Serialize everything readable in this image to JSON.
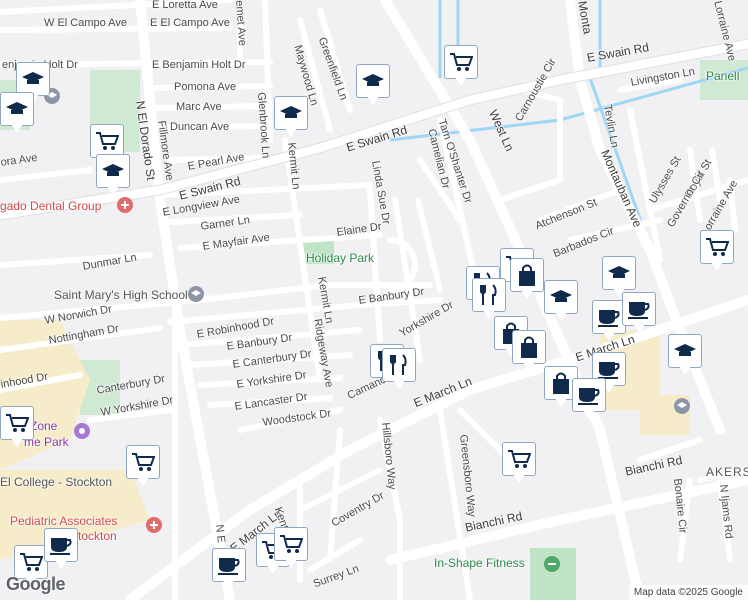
{
  "map": {
    "streets": [
      {
        "label": "E Loretta Ave"
      },
      {
        "label": "W El Campo Ave"
      },
      {
        "label": "E El Campo Ave"
      },
      {
        "label": "enjamin Holt Dr"
      },
      {
        "label": "E Benjamin Holt Dr"
      },
      {
        "label": "Pomona Ave"
      },
      {
        "label": "Marc Ave"
      },
      {
        "label": "Duncan Ave"
      },
      {
        "label": "E Pearl Ave"
      },
      {
        "label": "ora Ave"
      },
      {
        "label": "E Swain Rd"
      },
      {
        "label": "E Swain Rd"
      },
      {
        "label": "E Longview Ave"
      },
      {
        "label": "Garner Ln"
      },
      {
        "label": "E Mayfair Ave"
      },
      {
        "label": "Elaine Dr"
      },
      {
        "label": "Dunmar Ln"
      },
      {
        "label": "W Norwich Dr"
      },
      {
        "label": "Nottingham Dr"
      },
      {
        "label": "E Robinhood Dr"
      },
      {
        "label": "E Banbury Dr"
      },
      {
        "label": "E Banbury Dr"
      },
      {
        "label": "E Canterbury Dr"
      },
      {
        "label": "E Yorkshire Dr"
      },
      {
        "label": "E Lancaster Dr"
      },
      {
        "label": "Woodstock Dr"
      },
      {
        "label": "Camanche"
      },
      {
        "label": "Yorkshire Dr"
      },
      {
        "label": "Canterbury Dr"
      },
      {
        "label": "W Yorkshire Dr"
      },
      {
        "label": "inhood Dr"
      },
      {
        "label": "E March Ln"
      },
      {
        "label": "E March Ln"
      },
      {
        "label": "E March Ln"
      },
      {
        "label": "Coventry Dr"
      },
      {
        "label": "Surrey Ln"
      },
      {
        "label": "Bianchi Rd"
      },
      {
        "label": "Bianchi Rd"
      },
      {
        "label": "N El Dorado St"
      },
      {
        "label": "Fillmore Ave"
      },
      {
        "label": "Glenbrook Ln"
      },
      {
        "label": "Kermit Ln"
      },
      {
        "label": "Kermit Ln"
      },
      {
        "label": "Ridgeway Ave"
      },
      {
        "label": "Maywood Ln"
      },
      {
        "label": "Greenfield Ln"
      },
      {
        "label": "Linda Sue Dr"
      },
      {
        "label": "Tam O'Shanter Dr"
      },
      {
        "label": "Camelian Dr"
      },
      {
        "label": "West Ln"
      },
      {
        "label": "Carnoustie Cir"
      },
      {
        "label": "Atchenson St"
      },
      {
        "label": "Barbados Cir"
      },
      {
        "label": "Montauban Ave"
      },
      {
        "label": "Tevlin Ln"
      },
      {
        "label": "Livingston Ln"
      },
      {
        "label": "E Swain Rd"
      },
      {
        "label": "Hillsboro Way"
      },
      {
        "label": "Greensboro Way"
      },
      {
        "label": "Ulysses St"
      },
      {
        "label": "Royal St"
      },
      {
        "label": "Governor Cir"
      },
      {
        "label": "Lorraine Ave"
      },
      {
        "label": "Bonaire Cir"
      },
      {
        "label": "N Ijams Rd"
      },
      {
        "label": "Kentfield"
      },
      {
        "label": "N E"
      },
      {
        "label": "emet Ave"
      },
      {
        "label": "Lorraine Ave"
      },
      {
        "label": "Monta"
      }
    ],
    "places": [
      {
        "label": "Holiday Park",
        "kind": "park"
      },
      {
        "label": "Saint Mary's High School",
        "kind": "school"
      },
      {
        "label": "gado Dental Group",
        "kind": "medical"
      },
      {
        "label": "Zone",
        "kind": "entertainment"
      },
      {
        "label": "me Park",
        "kind": "entertainment"
      },
      {
        "label": "El College - Stockton",
        "kind": "school"
      },
      {
        "label": "Pediatric Associates",
        "kind": "medical"
      },
      {
        "label": "Stockton",
        "kind": "medical"
      },
      {
        "label": "In-Shape Fitness",
        "kind": "fitness"
      },
      {
        "label": "Panell",
        "kind": "park"
      },
      {
        "label": "AKERS",
        "kind": "area"
      }
    ],
    "brand": "Google",
    "attribution": "Map data ©2025 Google"
  }
}
